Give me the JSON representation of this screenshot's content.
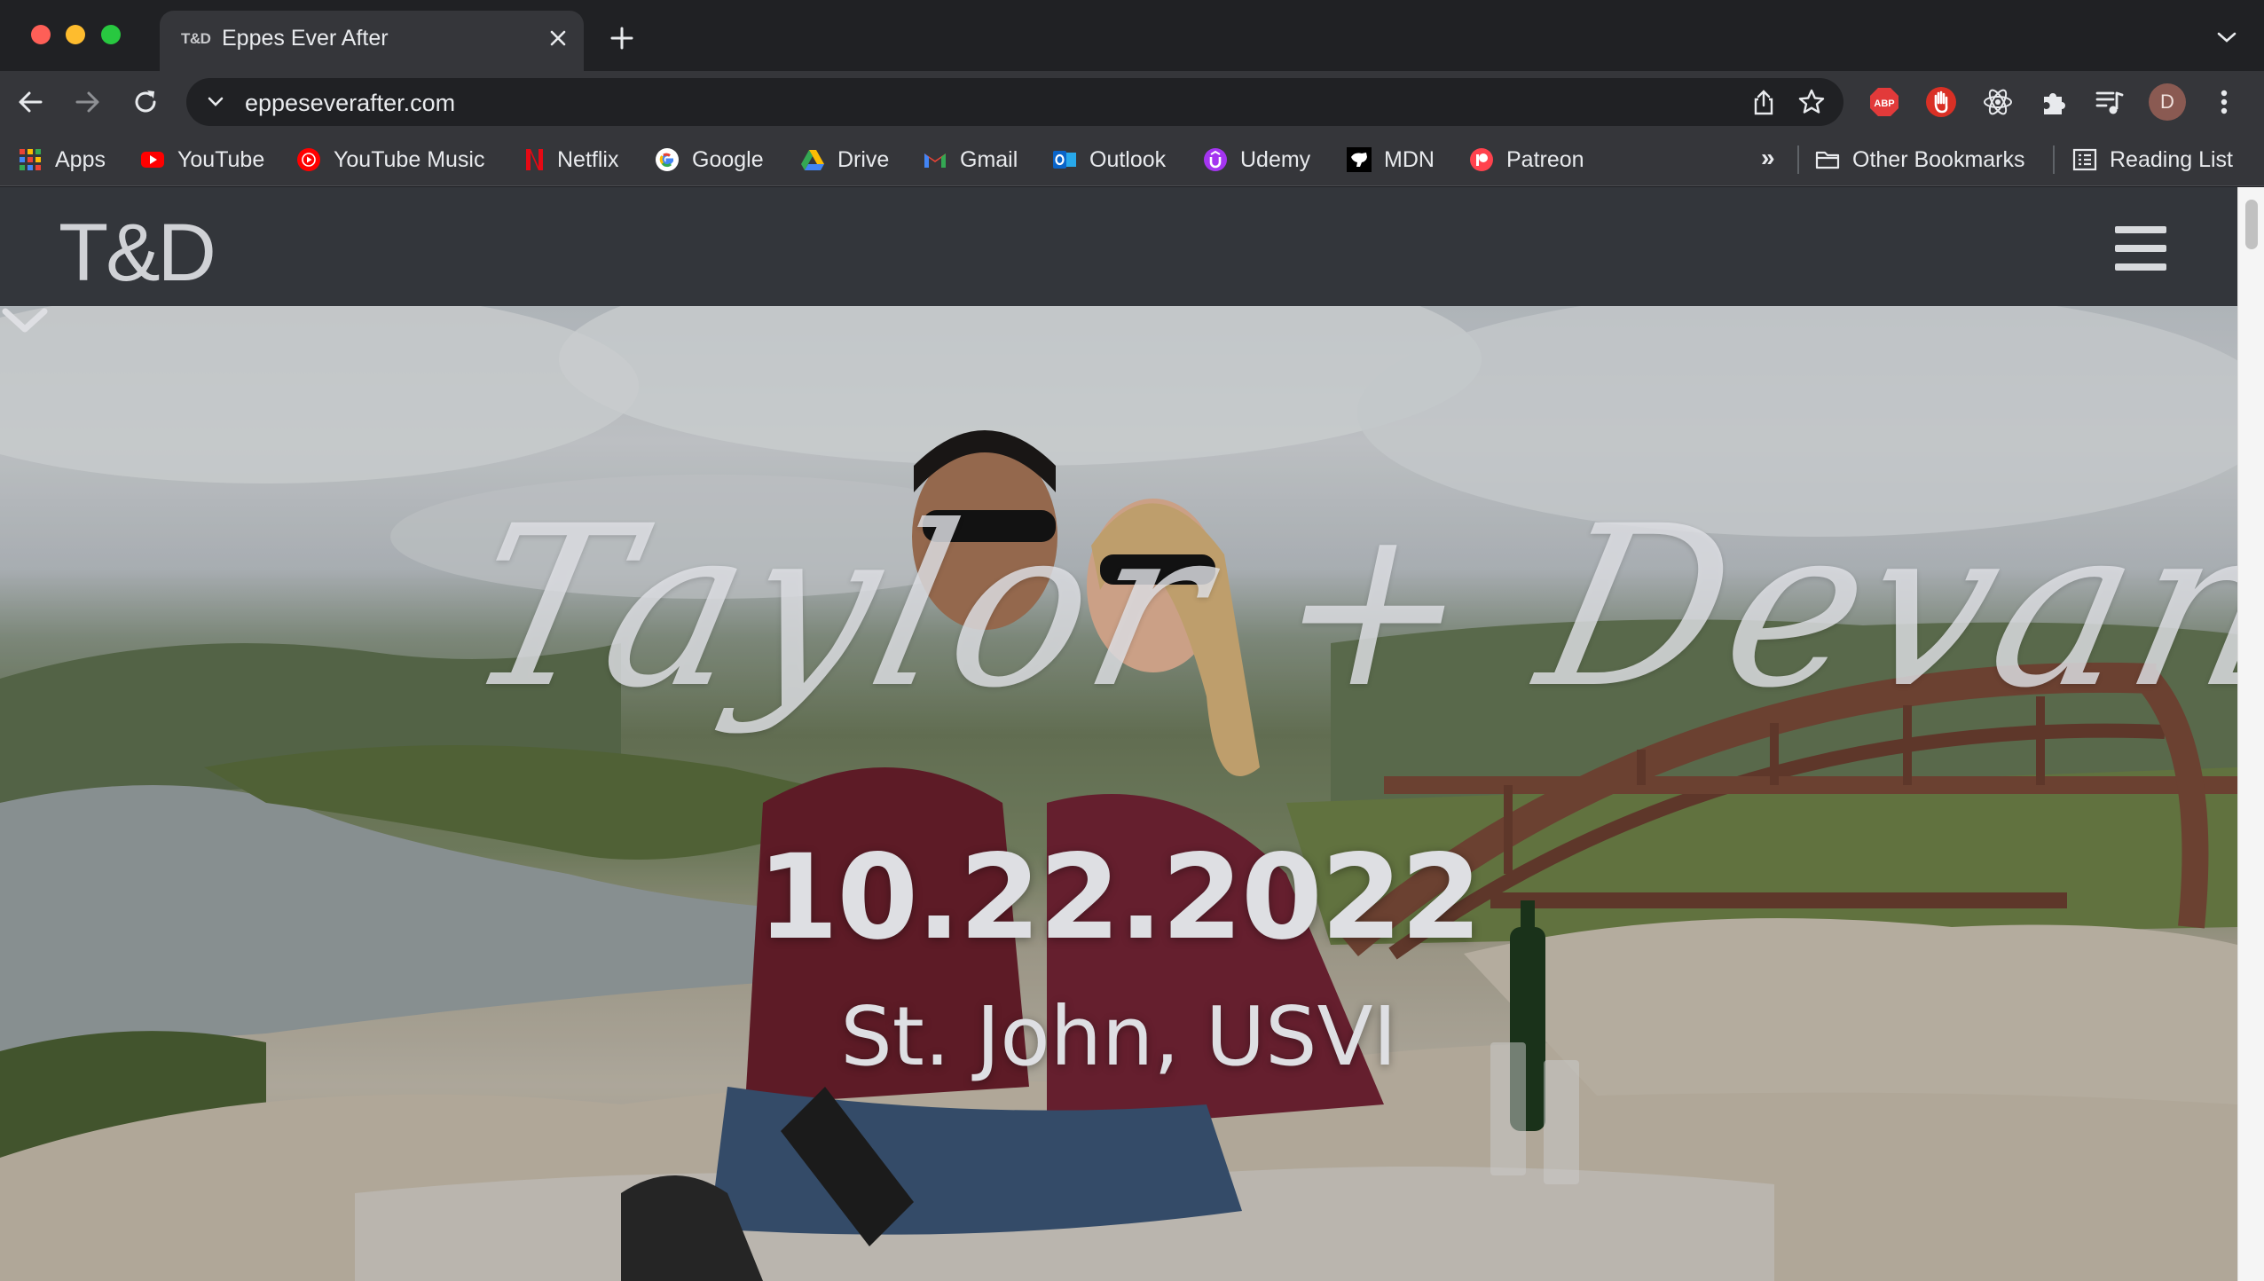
{
  "browser": {
    "tab": {
      "favicon_text": "T&D",
      "title": "Eppes Ever After"
    },
    "omnibox": {
      "url": "eppeseverafter.com"
    },
    "profile_initial": "D",
    "extensions": [
      {
        "name": "adblock-plus",
        "label": "ABP",
        "color": "#e23a3a"
      },
      {
        "name": "hand-stop",
        "color": "#d93025"
      },
      {
        "name": "react-devtools",
        "color": "#e8eaed"
      },
      {
        "name": "extensions-puzzle",
        "color": "#e8eaed"
      },
      {
        "name": "media-control",
        "color": "#e8eaed"
      }
    ]
  },
  "bookmarks": {
    "items": [
      {
        "label": "Apps",
        "icon": "apps-grid-icon"
      },
      {
        "label": "YouTube",
        "icon": "youtube-icon",
        "color": "#ff0000"
      },
      {
        "label": "YouTube Music",
        "icon": "youtube-music-icon",
        "color": "#ff0000"
      },
      {
        "label": "Netflix",
        "icon": "netflix-icon",
        "color": "#e50914"
      },
      {
        "label": "Google",
        "icon": "google-icon"
      },
      {
        "label": "Drive",
        "icon": "drive-icon"
      },
      {
        "label": "Gmail",
        "icon": "gmail-icon"
      },
      {
        "label": "Outlook",
        "icon": "outlook-icon",
        "color": "#0a64c8"
      },
      {
        "label": "Udemy",
        "icon": "udemy-icon",
        "color": "#a435f0"
      },
      {
        "label": "MDN",
        "icon": "mdn-icon"
      },
      {
        "label": "Patreon",
        "icon": "patreon-icon",
        "color": "#ff424d"
      }
    ],
    "more": "»",
    "other": "Other Bookmarks",
    "reading_list": "Reading List"
  },
  "site": {
    "logo": "T&D",
    "hero": {
      "names": "Taylor + Devan",
      "date": "10.22.2022",
      "location": "St. John, USVI"
    }
  },
  "colors": {
    "header_bg": "#33363b",
    "hero_text": "#dedfe3"
  }
}
